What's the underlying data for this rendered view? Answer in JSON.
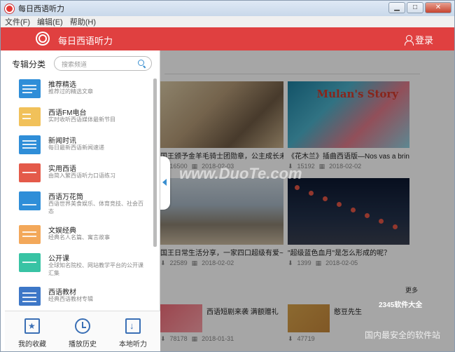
{
  "window": {
    "title": "每日西语听力",
    "buttons": {
      "minimize": "▁",
      "maximize": "□",
      "close": "✕"
    }
  },
  "menubar": [
    "文件(F)",
    "编辑(E)",
    "帮助(H)"
  ],
  "header": {
    "title": "每日西语听力",
    "login": "登录"
  },
  "panel": {
    "title": "专辑分类",
    "search_placeholder": "搜索频道",
    "items": [
      {
        "name": "推荐精选",
        "desc": "推荐过的精选文章",
        "icon": "recommend-icon"
      },
      {
        "name": "西语FM电台",
        "desc": "实时收听西语媒体最新节目",
        "icon": "radio-icon"
      },
      {
        "name": "新闻时讯",
        "desc": "每日最新西语新闻速递",
        "icon": "news-icon"
      },
      {
        "name": "实用西语",
        "desc": "由简入繁西语听力口语练习",
        "icon": "practical-icon"
      },
      {
        "name": "西语万花筒",
        "desc": "西语世界美食娱乐、体育竞技、社会百态",
        "icon": "kaleidoscope-icon"
      },
      {
        "name": "文娱经典",
        "desc": "经典名人名篇、寓言故事",
        "icon": "book-icon"
      },
      {
        "name": "公开课",
        "desc": "全球知名院校、网站教学平台的公开课汇集",
        "icon": "graduation-icon"
      },
      {
        "name": "西语教材",
        "desc": "经典西语教材专辑",
        "icon": "textbook-icon"
      }
    ],
    "bottom": {
      "favorites": "我的收藏",
      "history": "播放历史",
      "local": "本地听力"
    }
  },
  "content": {
    "cards": [
      {
        "caption": "国王颁予金羊毛骑士团勋章，公主成长未来",
        "plays": "16500",
        "date": "2018-02-03"
      },
      {
        "caption": "《花木兰》插曲西语版—Nos vas a brindar",
        "plays": "15192",
        "date": "2018-02-02"
      },
      {
        "caption": "国王日常生活分享，一家四口超级有爱~",
        "plays": "22589",
        "date": "2018-02-02"
      },
      {
        "caption": "\"超级蓝色血月\"是怎么形成的呢？",
        "plays": "1399",
        "date": "2018-02-05"
      },
      {
        "caption": "西语短剧来袭 满额赠礼",
        "plays": "78178",
        "date": "2018-01-31"
      },
      {
        "caption": "憨豆先生",
        "plays": "47719",
        "date": ""
      }
    ],
    "mulan_title": "Mulan's Story",
    "more": "更多",
    "watermark": "www.DuoTe.com"
  },
  "watermark_corner": "2345软件大全",
  "watermark_corner2": "国内最安全的软件站"
}
